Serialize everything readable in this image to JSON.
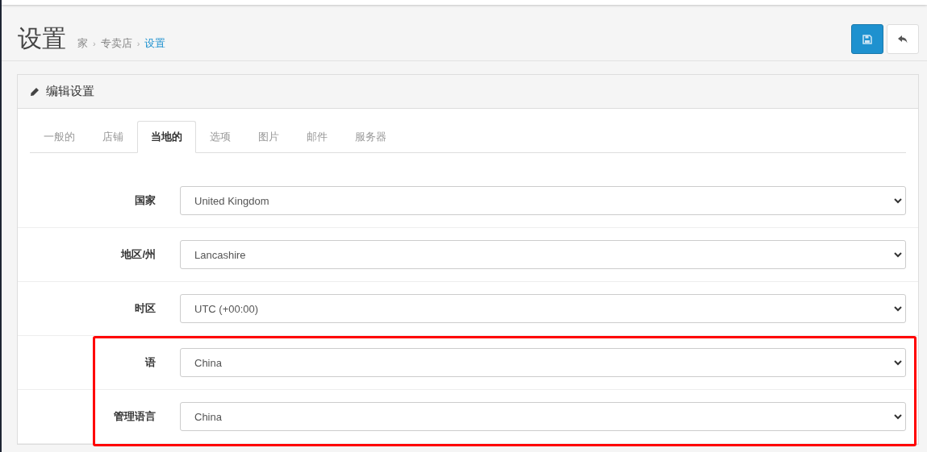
{
  "header": {
    "title": "设置",
    "breadcrumb": [
      {
        "label": "家",
        "selected": false
      },
      {
        "separator": "›",
        "label": "专卖店",
        "selected": false
      },
      {
        "separator": "›",
        "label": "设置",
        "selected": true
      }
    ]
  },
  "panel": {
    "title": "编辑设置",
    "tabs": [
      {
        "label": "一般的",
        "selected": false
      },
      {
        "label": "店铺",
        "selected": false
      },
      {
        "label": "当地的",
        "selected": true
      },
      {
        "label": "选项",
        "selected": false
      },
      {
        "label": "图片",
        "selected": false
      },
      {
        "label": "邮件",
        "selected": false
      },
      {
        "label": "服务器",
        "selected": false
      }
    ],
    "fields": [
      {
        "label": "国家",
        "value": "United Kingdom",
        "highlighted": false
      },
      {
        "label": "地区/州",
        "value": "Lancashire",
        "highlighted": false
      },
      {
        "label": "时区",
        "value": "UTC (+00:00)",
        "highlighted": false
      },
      {
        "label": "语",
        "value": "China",
        "highlighted": true
      },
      {
        "label": "管理语言",
        "value": "China",
        "highlighted": true
      }
    ]
  }
}
